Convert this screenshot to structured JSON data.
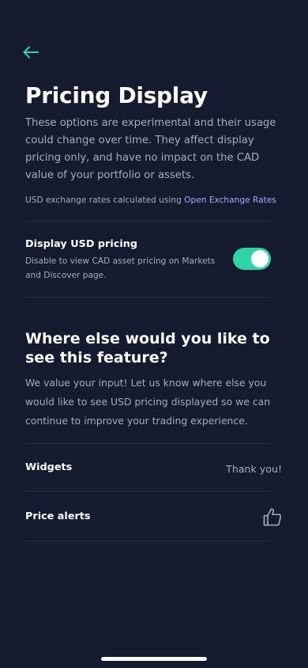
{
  "header": {
    "back_icon": "arrow-left-icon",
    "accent_color": "#2ed3a8",
    "title": "Pricing Display"
  },
  "intro": {
    "text": "These options are experimental and their usage could change over time. They affect display pricing only, and have no impact on the CAD value of your portfolio or assets."
  },
  "fx_note": {
    "prefix": "USD exchange rates calculated using ",
    "link_label": "Open Exchange Rates",
    "link_color": "#b3a4ff"
  },
  "setting": {
    "title": "Display USD pricing",
    "description": "Disable to view CAD asset pricing on Markets and Discover page.",
    "enabled": true
  },
  "feedback": {
    "title": "Where else would you like to see this feature?",
    "description": "We value your input! Let us know where else you would like to see USD pricing displayed so we can continue to improve your trading experience.",
    "options": [
      {
        "label": "Widgets",
        "status": "Thank you!"
      },
      {
        "label": "Price alerts",
        "icon": "thumbs-up-icon"
      }
    ]
  },
  "colors": {
    "background": "#161a2e",
    "muted_text": "#a7abbd",
    "divider": "#2b2f45"
  }
}
